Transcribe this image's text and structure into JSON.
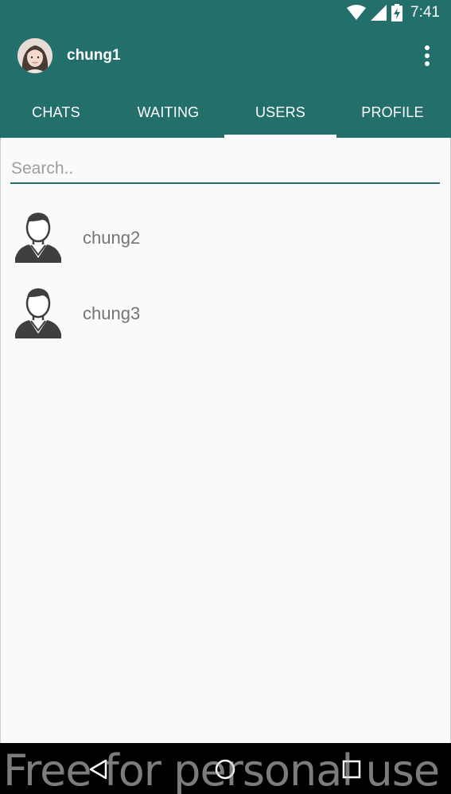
{
  "status_bar": {
    "time": "7:41",
    "icons": [
      "wifi-icon",
      "signal-icon",
      "battery-charging-icon"
    ]
  },
  "toolbar": {
    "username": "chung1",
    "menu_icon": "more-vert-icon"
  },
  "tabs": [
    {
      "label": "CHATS",
      "active": false
    },
    {
      "label": "WAITING",
      "active": false
    },
    {
      "label": "USERS",
      "active": true
    },
    {
      "label": "PROFILE",
      "active": false
    }
  ],
  "search": {
    "placeholder": "Search..",
    "value": ""
  },
  "users": [
    {
      "name": "chung2",
      "icon": "user-avatar-icon"
    },
    {
      "name": "chung3",
      "icon": "user-avatar-icon"
    }
  ],
  "nav_bar": {
    "buttons": [
      "back-icon",
      "home-icon",
      "recents-icon"
    ]
  },
  "watermark": "Free for personal use",
  "colors": {
    "primary": "#236f6b",
    "background": "#fafafa",
    "user_text": "#757575",
    "placeholder": "#9e9e9e"
  }
}
